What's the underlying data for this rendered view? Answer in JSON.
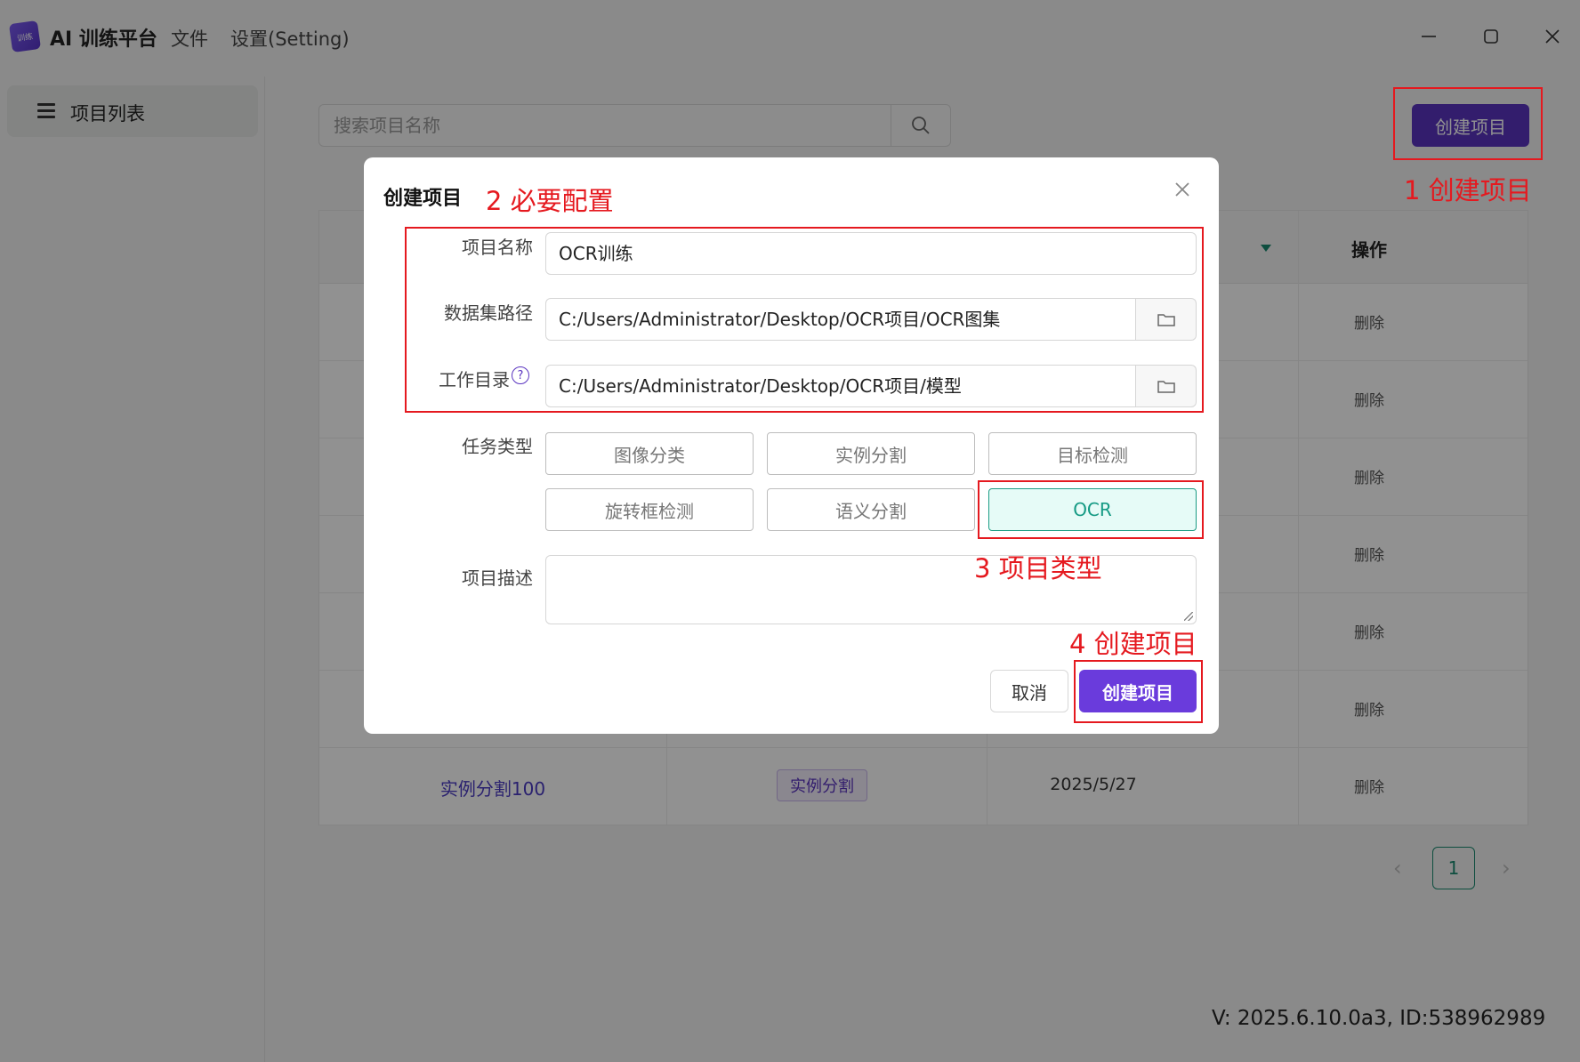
{
  "app": {
    "title": "AI 训练平台",
    "logo_text": "训练",
    "menus": [
      "文件",
      "设置(Setting)"
    ]
  },
  "sidebar": {
    "items": [
      {
        "label": "项目列表"
      }
    ]
  },
  "search": {
    "placeholder": "搜索项目名称"
  },
  "toolbar": {
    "create_label": "创建项目"
  },
  "table": {
    "op_header": "操作",
    "delete_label": "删除",
    "last_row": {
      "name": "实例分割100",
      "type": "实例分割",
      "date": "2025/5/27"
    }
  },
  "pagination": {
    "current": "1",
    "prev": "‹",
    "next": "›"
  },
  "version": "V: 2025.6.10.0a3, ID:538962989",
  "modal": {
    "title": "创建项目",
    "fields": {
      "name_label": "项目名称",
      "name_value": "OCR训练",
      "dataset_label": "数据集路径",
      "dataset_value": "C:/Users/Administrator/Desktop/OCR项目/OCR图集",
      "workdir_label": "工作目录",
      "workdir_value": "C:/Users/Administrator/Desktop/OCR项目/模型",
      "task_label": "任务类型",
      "desc_label": "项目描述"
    },
    "task_types": [
      {
        "label": "图像分类"
      },
      {
        "label": "实例分割"
      },
      {
        "label": "目标检测"
      },
      {
        "label": "旋转框检测"
      },
      {
        "label": "语义分割"
      },
      {
        "label": "OCR",
        "selected": true
      }
    ],
    "cancel_label": "取消",
    "create_label": "创建项目"
  },
  "annotations": {
    "step1": "1 创建项目",
    "step2": "2 必要配置",
    "step3": "3 项目类型",
    "step4": "4 创建项目"
  },
  "colors": {
    "accent": "#5a34c0",
    "selected_task": "#159a84",
    "annotation_red": "#e5191f"
  }
}
